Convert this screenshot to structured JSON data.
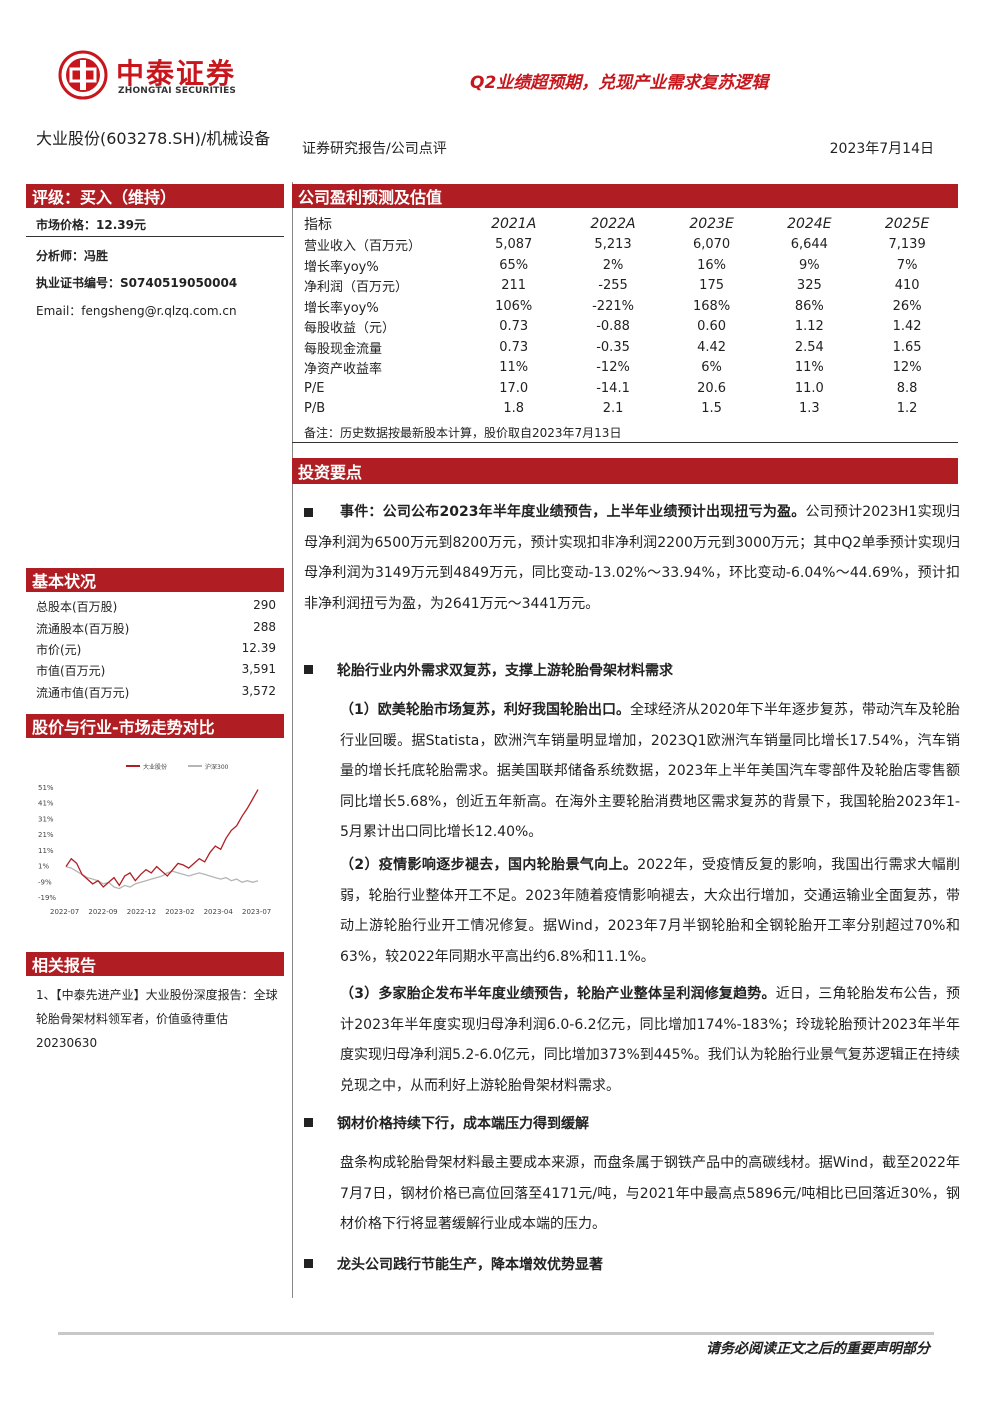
{
  "header": {
    "logo_cn": "中泰证券",
    "logo_en": "ZHONGTAI SECURITIES",
    "headline": "Q2业绩超预期，兑现产业需求复苏逻辑",
    "stock_name": "大业股份(603278.SH)/机械设备",
    "report_type": "证券研究报告/公司点评",
    "date": "2023年7月14日"
  },
  "rating": {
    "title": "评级：买入（维持）",
    "price": "市场价格：12.39元",
    "analyst": "分析师：冯胜",
    "license": "执业证书编号：S0740519050004",
    "email": "Email：fengsheng@r.qlzq.com.cn"
  },
  "forecast": {
    "title": "公司盈利预测及估值",
    "columns": [
      "指标",
      "2021A",
      "2022A",
      "2023E",
      "2024E",
      "2025E"
    ],
    "rows": [
      [
        "营业收入（百万元）",
        "5,087",
        "5,213",
        "6,070",
        "6,644",
        "7,139"
      ],
      [
        "增长率yoy%",
        "65%",
        "2%",
        "16%",
        "9%",
        "7%"
      ],
      [
        "净利润（百万元）",
        "211",
        "-255",
        "175",
        "325",
        "410"
      ],
      [
        "增长率yoy%",
        "106%",
        "-221%",
        "168%",
        "86%",
        "26%"
      ],
      [
        "每股收益（元）",
        "0.73",
        "-0.88",
        "0.60",
        "1.12",
        "1.42"
      ],
      [
        "每股现金流量",
        "0.73",
        "-0.35",
        "4.42",
        "2.54",
        "1.65"
      ],
      [
        "净资产收益率",
        "11%",
        "-12%",
        "6%",
        "11%",
        "12%"
      ],
      [
        "P/E",
        "17.0",
        "-14.1",
        "20.6",
        "11.0",
        "8.8"
      ],
      [
        "P/B",
        "1.8",
        "2.1",
        "1.5",
        "1.3",
        "1.2"
      ]
    ],
    "note": "备注：历史数据按最新股本计算，股价取自2023年7月13日"
  },
  "basic": {
    "title": "基本状况",
    "rows": [
      {
        "label": "总股本(百万股)",
        "value": "290"
      },
      {
        "label": "流通股本(百万股)",
        "value": "288"
      },
      {
        "label": "市价(元)",
        "value": "12.39"
      },
      {
        "label": "市值(百万元)",
        "value": "3,591"
      },
      {
        "label": "流通市值(百万元)",
        "value": "3,572"
      }
    ]
  },
  "price_chart": {
    "title": "股价与行业-市场走势对比"
  },
  "chart_data": {
    "type": "line",
    "legend": [
      "大业股份",
      "沪深300"
    ],
    "y_ticks": [
      "51%",
      "41%",
      "31%",
      "21%",
      "11%",
      "1%",
      "-9%",
      "-19%"
    ],
    "x_ticks": [
      "2022-07",
      "2022-09",
      "2022-12",
      "2023-02",
      "2023-04",
      "2023-07"
    ],
    "ylim": [
      -19,
      51
    ],
    "series": [
      {
        "name": "大业股份",
        "color": "#b01e23",
        "values": [
          1,
          6,
          3,
          -4,
          -7,
          -10,
          -8,
          -12,
          -9,
          -6,
          -11,
          -5,
          -3,
          -8,
          -4,
          -1,
          -3,
          1,
          -2,
          -5,
          -1,
          3,
          2,
          0,
          3,
          6,
          4,
          10,
          14,
          12,
          19,
          24,
          27,
          33,
          38,
          44,
          50
        ]
      },
      {
        "name": "沪深300",
        "color": "#b5b5b5",
        "values": [
          1,
          0,
          -2,
          -4,
          -6,
          -7,
          -8,
          -10,
          -9,
          -12,
          -13,
          -11,
          -12,
          -10,
          -9,
          -8,
          -7,
          -6,
          -5,
          -3,
          -2,
          -3,
          -4,
          -5,
          -4,
          -3,
          -4,
          -5,
          -6,
          -7,
          -6,
          -8,
          -7,
          -9,
          -8,
          -9,
          -8
        ]
      }
    ]
  },
  "related": {
    "title": "相关报告",
    "text": "1、【中泰先进产业】大业股份深度报告：全球轮胎骨架材料领军者，价值亟待重估 20230630"
  },
  "invest": {
    "title": "投资要点",
    "p1_bold": "事件：公司公布2023年半年度业绩预告，上半年业绩预计出现扭亏为盈。",
    "p1_text": "公司预计2023H1实现归母净利润为6500万元到8200万元，预计实现扣非净利润2200万元到3000万元；其中Q2单季预计实现归母净利润为3149万元到4849万元，同比变动-13.02%～33.94%，环比变动-6.04%～44.69%，预计扣非净利润扭亏为盈，为2641万元～3441万元。",
    "h2": "轮胎行业内外需求双复苏，支撑上游轮胎骨架材料需求",
    "p2_bold": "（1）欧美轮胎市场复苏，利好我国轮胎出口。",
    "p2_text": "全球经济从2020年下半年逐步复苏，带动汽车及轮胎行业回暖。据Statista，欧洲汽车销量明显增加，2023Q1欧洲汽车销量同比增长17.54%，汽车销量的增长托底轮胎需求。据美国联邦储备系统数据，2023年上半年美国汽车零部件及轮胎店零售额同比增长5.68%，创近五年新高。在海外主要轮胎消费地区需求复苏的背景下，我国轮胎2023年1-5月累计出口同比增长12.40%。",
    "p3_bold": "（2）疫情影响逐步褪去，国内轮胎景气向上。",
    "p3_text": "2022年，受疫情反复的影响，我国出行需求大幅削弱，轮胎行业整体开工不足。2023年随着疫情影响褪去，大众出行增加，交通运输业全面复苏，带动上游轮胎行业开工情况修复。据Wind，2023年7月半钢轮胎和全钢轮胎开工率分别超过70%和63%，较2022年同期水平高出约6.8%和11.1%。",
    "p4_bold": "（3）多家胎企发布半年度业绩预告，轮胎产业整体呈利润修复趋势。",
    "p4_text": "近日，三角轮胎发布公告，预计2023年半年度实现归母净利润6.0-6.2亿元，同比增加174%-183%；玲珑轮胎预计2023年半年度实现归母净利润5.2-6.0亿元，同比增加373%到445%。我们认为轮胎行业景气复苏逻辑正在持续兑现之中，从而利好上游轮胎骨架材料需求。",
    "h5": "钢材价格持续下行，成本端压力得到缓解",
    "p5_text": "盘条构成轮胎骨架材料最主要成本来源，而盘条属于钢铁产品中的高碳线材。据Wind，截至2022年7月7日，钢材价格已高位回落至4171元/吨，与2021年中最高点5896元/吨相比已回落近30%，钢材价格下行将显著缓解行业成本端的压力。",
    "h6": "龙头公司践行节能生产，降本增效优势显著"
  },
  "footer": {
    "text": "请务必阅读正文之后的重要声明部分"
  }
}
